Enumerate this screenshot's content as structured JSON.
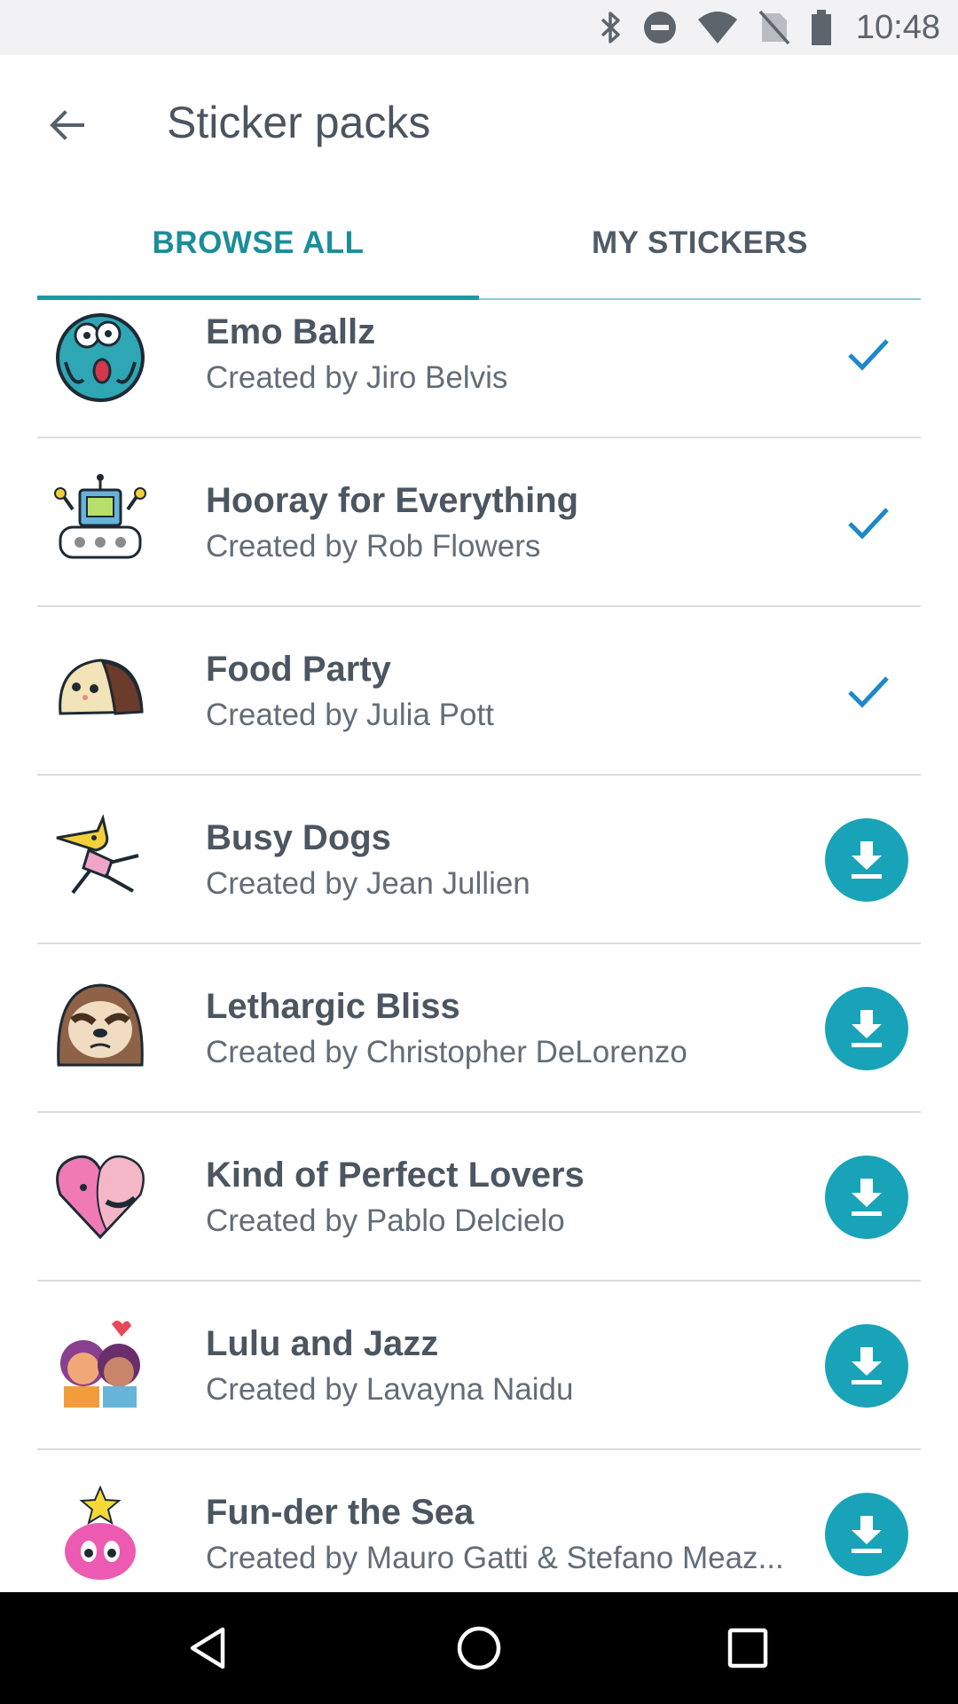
{
  "status_bar": {
    "time": "10:48",
    "icons": [
      "bluetooth-icon",
      "do-not-disturb-icon",
      "wifi-icon",
      "no-sim-icon",
      "battery-icon"
    ]
  },
  "app_bar": {
    "back_icon": "arrow-back-icon",
    "title": "Sticker packs"
  },
  "tabs": [
    {
      "label": "BROWSE ALL",
      "selected": true
    },
    {
      "label": "MY STICKERS",
      "selected": false
    }
  ],
  "colors": {
    "accent": "#1a8e99",
    "download_button": "#19a3b8",
    "check": "#1e88c8"
  },
  "packs": [
    {
      "name": "Emo Ballz",
      "author": "Created by Jiro Belvis",
      "status": "installed",
      "action_icon": "check-icon"
    },
    {
      "name": "Hooray for Everything",
      "author": "Created by Rob Flowers",
      "status": "installed",
      "action_icon": "check-icon"
    },
    {
      "name": "Food Party",
      "author": "Created by Julia Pott",
      "status": "installed",
      "action_icon": "check-icon"
    },
    {
      "name": "Busy Dogs",
      "author": "Created by Jean Jullien",
      "status": "available",
      "action_icon": "download-icon"
    },
    {
      "name": "Lethargic Bliss",
      "author": "Created by Christopher DeLorenzo",
      "status": "available",
      "action_icon": "download-icon"
    },
    {
      "name": "Kind of Perfect Lovers",
      "author": "Created by Pablo Delcielo",
      "status": "available",
      "action_icon": "download-icon"
    },
    {
      "name": "Lulu and Jazz",
      "author": "Created by Lavayna Naidu",
      "status": "available",
      "action_icon": "download-icon"
    },
    {
      "name": "Fun-der the Sea",
      "author": "Created by Mauro Gatti & Stefano Meaz...",
      "status": "available",
      "action_icon": "download-icon"
    }
  ],
  "nav_bar": {
    "icons": [
      "back-triangle-icon",
      "home-circle-icon",
      "recents-square-icon"
    ]
  }
}
